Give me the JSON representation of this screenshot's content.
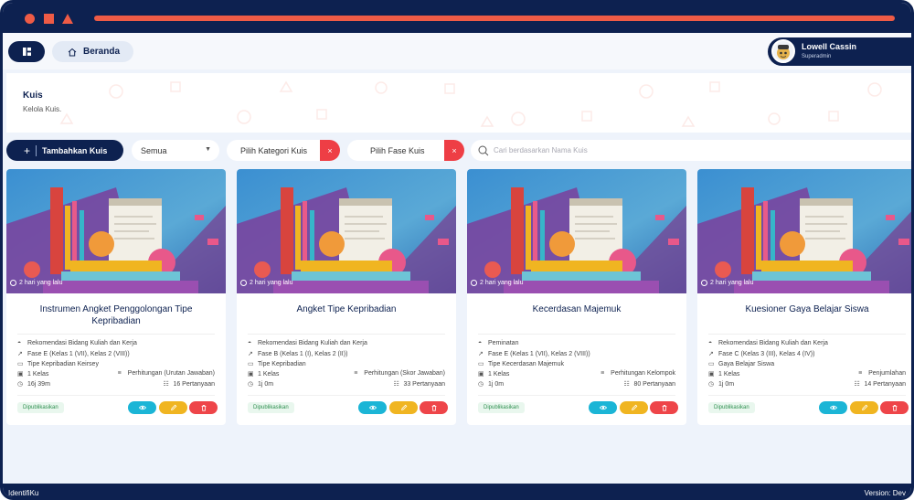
{
  "topbar": {
    "home_label": "Beranda"
  },
  "user": {
    "name": "Lowell Cassin",
    "role": "Superadmin"
  },
  "header": {
    "title": "Kuis",
    "subtitle": "Kelola Kuis."
  },
  "filters": {
    "add_label": "Tambahkan Kuis",
    "status_value": "Semua",
    "category_label": "Pilih Kategori Kuis",
    "phase_label": "Pilih Fase Kuis",
    "search_placeholder": "Cari berdasarkan Nama Kuis",
    "clear_icon": "×"
  },
  "cards": [
    {
      "time": "2 hari yang lalu",
      "title": "Instrumen Angket Penggolongan Tipe Kepribadian",
      "recommendation": "Rekomendasi Bidang Kuliah dan Kerja",
      "phase": "Fase E (Kelas 1 (VII), Kelas 2 (VIII))",
      "type": "Tipe Kepribadian Keirsey",
      "classes": "1 Kelas",
      "calculation": "Perhitungan (Urutan Jawaban)",
      "duration": "16j 39m",
      "questions": "16 Pertanyaan",
      "status": "Dipublikasikan"
    },
    {
      "time": "2 hari yang lalu",
      "title": "Angket Tipe Kepribadian",
      "recommendation": "Rekomendasi Bidang Kuliah dan Kerja",
      "phase": "Fase B (Kelas 1 (I), Kelas 2 (II))",
      "type": "Tipe Kepribadian",
      "classes": "1 Kelas",
      "calculation": "Perhitungan (Skor Jawaban)",
      "duration": "1j 0m",
      "questions": "33 Pertanyaan",
      "status": "Dipublikasikan"
    },
    {
      "time": "2 hari yang lalu",
      "title": "Kecerdasan Majemuk",
      "recommendation": "Peminatan",
      "phase": "Fase E (Kelas 1 (VII), Kelas 2 (VIII))",
      "type": "Tipe Kecerdasan Majemuk",
      "classes": "1 Kelas",
      "calculation": "Perhitungan Kelompok",
      "duration": "1j 0m",
      "questions": "80 Pertanyaan",
      "status": "Dipublikasikan"
    },
    {
      "time": "2 hari yang lalu",
      "title": "Kuesioner Gaya Belajar Siswa",
      "recommendation": "Rekomendasi Bidang Kuliah dan Kerja",
      "phase": "Fase C (Kelas 3 (III), Kelas 4 (IV))",
      "type": "Gaya Belajar Siswa",
      "classes": "1 Kelas",
      "calculation": "Penjumlahan",
      "duration": "1j 0m",
      "questions": "14 Pertanyaan",
      "status": "Dipublikasikan"
    }
  ],
  "footer": {
    "brand": "IdentifiKu",
    "version": "Version: Dev"
  },
  "colors": {
    "navy": "#0d2150",
    "coral": "#ee5b46",
    "view": "#1bb5d6",
    "edit": "#f0b521",
    "delete": "#ee4549"
  }
}
